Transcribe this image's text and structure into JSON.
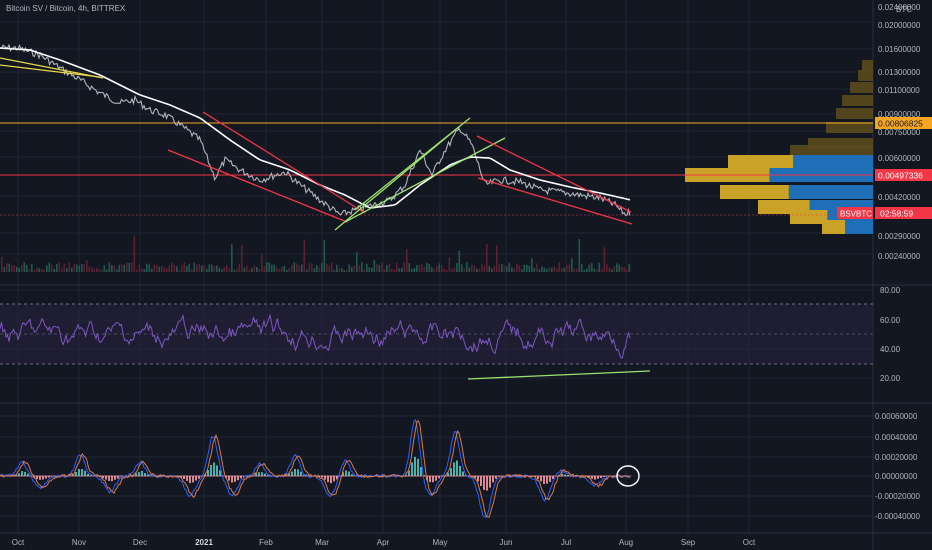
{
  "header": {
    "symbol_title": "Bitcoin SV / Bitcoin, 4h, BITTREX",
    "currency": "BTC"
  },
  "colors": {
    "background": "#131722",
    "grid": "#1f2433",
    "axis_text": "#b2b5be",
    "price_line": "#b2b5be",
    "ma_line": "#ffffff",
    "red_line": "#f23645",
    "orange_line": "#f5a623",
    "green_line": "#9be36e",
    "yellow_line": "#e8d84a",
    "rsi_line": "#7e57c2",
    "rsi_band": "#2a2340",
    "osc_blue": "#2962ff",
    "osc_orange": "#e07a3f",
    "hist_teal": "#4dd0c8",
    "hist_pink": "#ff9ea8",
    "vp_gold": "#c9a227",
    "vp_blue": "#1e6fb8"
  },
  "price_axis": {
    "labels": [
      "0.02400000",
      "0.02000000",
      "0.01600000",
      "0.01300000",
      "0.01100000",
      "0.00900000",
      "0.00750000",
      "0.00600000",
      "0.00420000",
      "0.00340000",
      "0.00290000",
      "0.00240000"
    ],
    "badges": {
      "orange": "0.00806825",
      "red": "0.00497336",
      "symbol": "BSVBTC",
      "countdown": "02:58:59"
    }
  },
  "rsi_axis": {
    "labels": [
      "80.00",
      "60.00",
      "40.00",
      "20.00"
    ]
  },
  "osc_axis": {
    "labels": [
      "0.00060000",
      "0.00040000",
      "0.00020000",
      "0.00000000",
      "-0.00020000",
      "-0.00040000"
    ]
  },
  "time_axis": {
    "labels": [
      "Oct",
      "Nov",
      "Dec",
      "2021",
      "Feb",
      "Mar",
      "Apr",
      "May",
      "Jun",
      "Jul",
      "Aug",
      "Sep",
      "Oct"
    ]
  },
  "chart_data": {
    "type": "line",
    "title": "Bitcoin SV / Bitcoin, 4h, BITTREX",
    "x": [
      "Oct",
      "Nov",
      "Dec",
      "2021",
      "Feb",
      "Mar",
      "Apr",
      "May",
      "Jun",
      "Jul",
      "Aug"
    ],
    "ylabel": "BTC",
    "series": [
      {
        "values": [
          0.016,
          0.0125,
          0.0105,
          0.0085,
          0.0052,
          0.0038,
          0.004,
          0.007,
          0.0049,
          0.0043,
          0.0039
        ]
      }
    ],
    "horizontal_levels": [
      0.00806825,
      0.00497336
    ],
    "rsi": {
      "ylim": [
        20,
        80
      ],
      "trend_line": [
        20,
        25
      ]
    }
  }
}
